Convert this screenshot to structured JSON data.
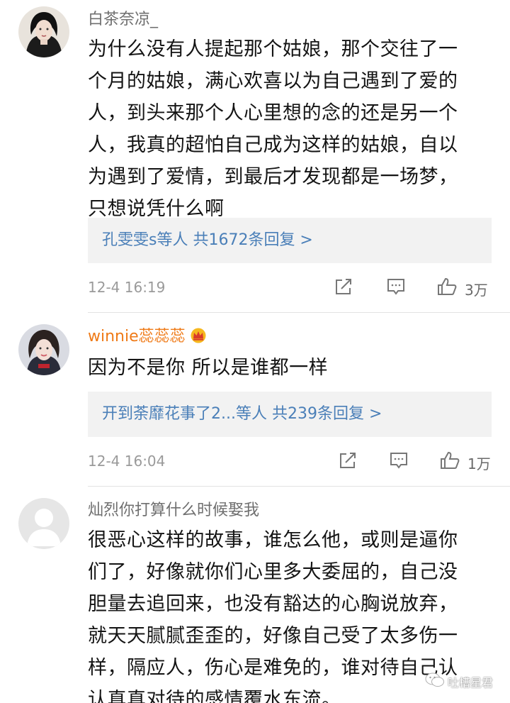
{
  "comments": [
    {
      "username": "白茶奈凉_",
      "lines": [
        "为什么没有人提起那个姑娘，那个交往了一",
        "个月的姑娘，满心欢喜以为自己遇到了爱的",
        "人，到头来那个人心里想的念的还是另一个",
        "人，我真的超怕自己成为这样的姑娘，自以",
        "为遇到了爱情，到最后才发现都是一场梦，",
        "只想说凭什么啊"
      ],
      "replies": "孔雯雯s等人  共1672条回复 >",
      "time": "12-4 16:19",
      "likes": "3万"
    },
    {
      "username": "winnie蕊蕊蕊",
      "lines": [
        "因为不是你 所以是谁都一样"
      ],
      "replies": "开到荼靡花事了2...等人  共239条回复 >",
      "time": "12-4 16:04",
      "likes": "1万"
    },
    {
      "username": "灿烈你打算什么时候娶我",
      "lines": [
        "很恶心这样的故事，谁怎么他，或则是逼你",
        "们了，好像就你们心里多大委屈的，自己没",
        "胆量去追回来，也没有豁达的心胸说放弃，",
        "就天天腻腻歪歪的，好像自己受了太多伤一",
        "样，隔应人，伤心是难免的，谁对待自己认",
        "认真真对待的感情覆水东流。"
      ]
    }
  ],
  "icons": {
    "repost": "share-icon",
    "comment": "comment-icon",
    "like": "thumbs-up-icon",
    "vip": "crown-icon"
  },
  "colors": {
    "username": "#6f6f6f",
    "vip_username": "#ef7a17",
    "reply_link": "#4a7fb8",
    "reply_bg": "#f2f2f2"
  },
  "watermark": "吐槽星君"
}
